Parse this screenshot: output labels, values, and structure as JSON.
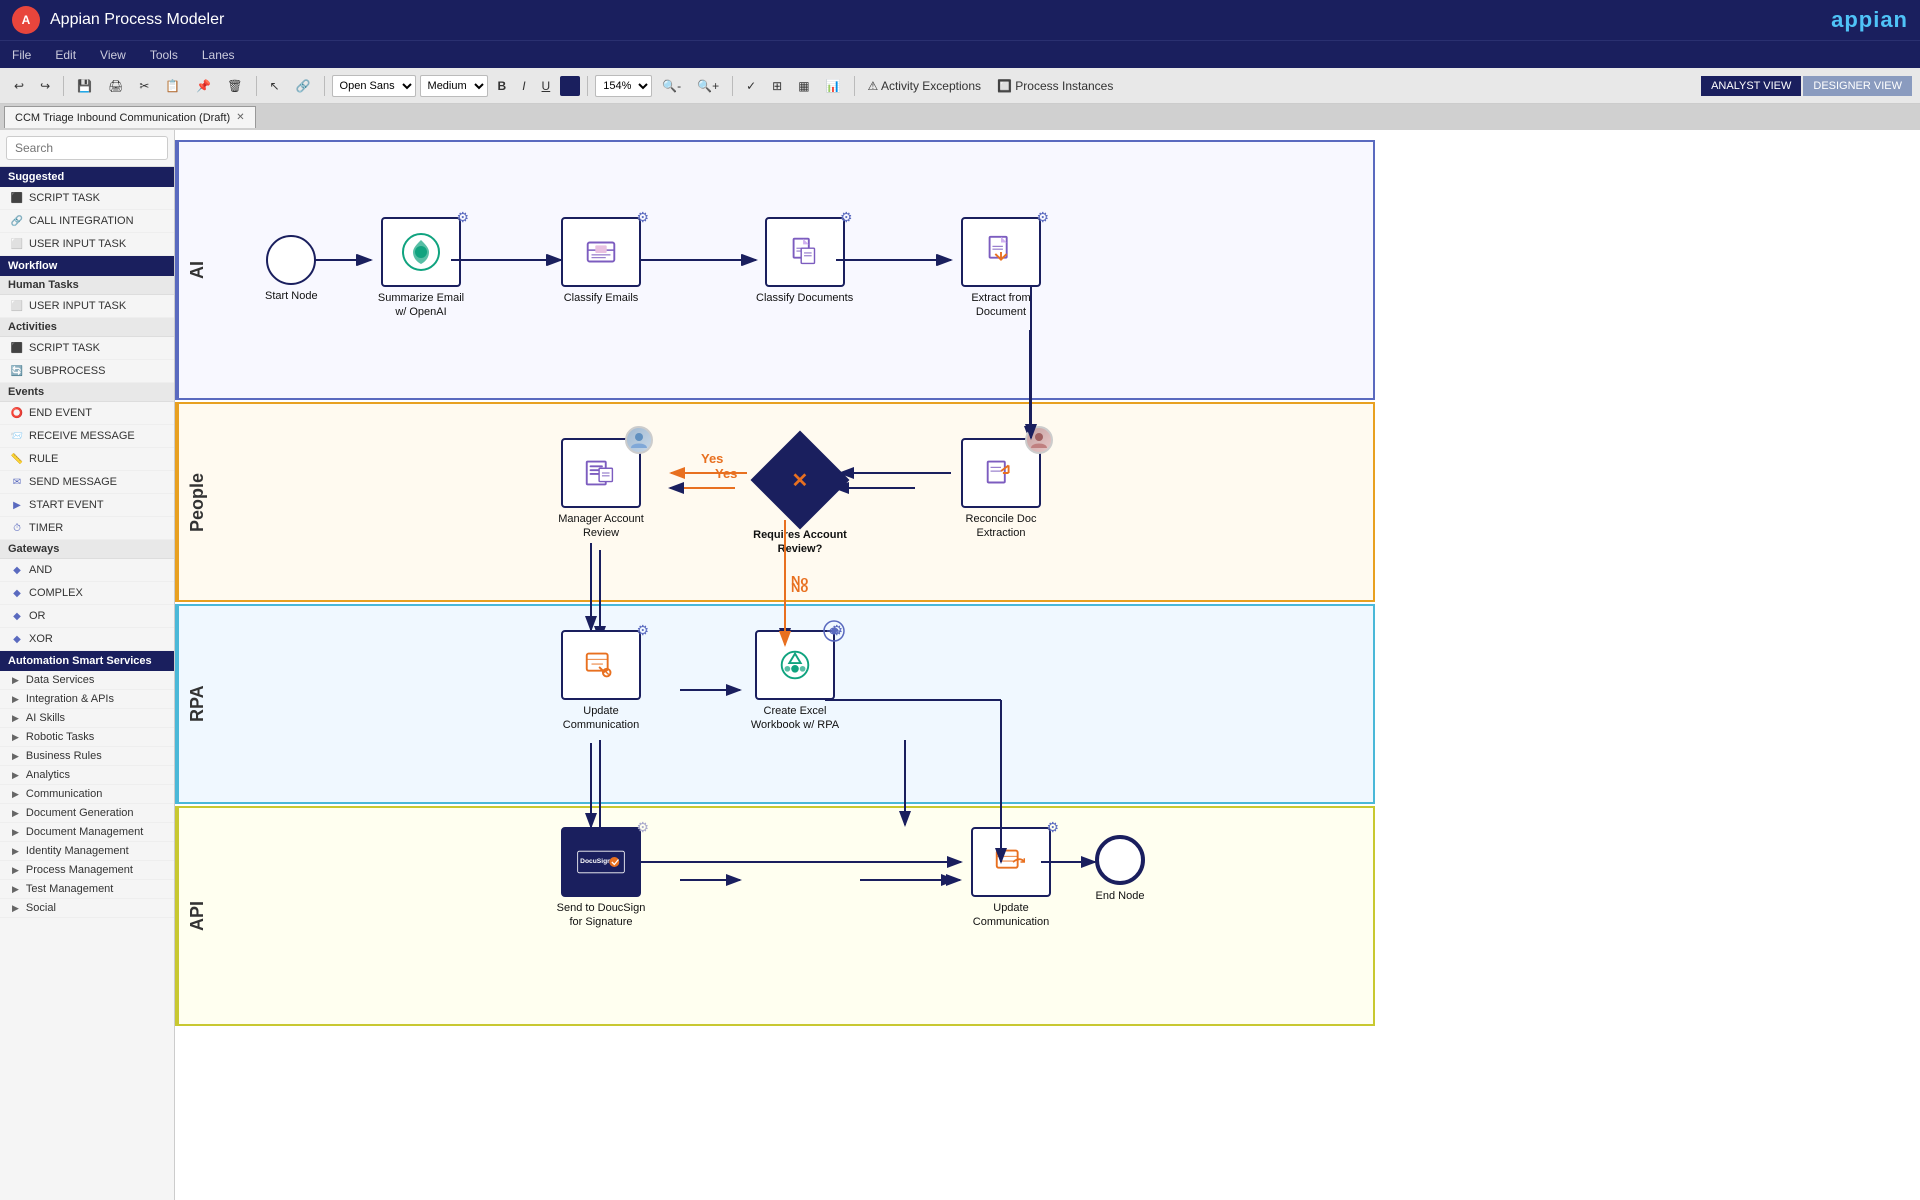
{
  "app": {
    "title": "Appian Process Modeler",
    "logo_text": "A",
    "appian_brand": "appian"
  },
  "menu": {
    "items": [
      "File",
      "Edit",
      "View",
      "Tools",
      "Lanes"
    ]
  },
  "toolbar": {
    "font": "Open Sans",
    "size": "Medium",
    "zoom": "154%",
    "activity_exceptions": "Activity Exceptions",
    "process_instances": "Process Instances",
    "analyst_view": "ANALYST VIEW",
    "designer_view": "DESIGNER VIEW"
  },
  "tab": {
    "label": "CCM Triage Inbound Communication (Draft)"
  },
  "sidebar": {
    "search_placeholder": "Search",
    "suggested_label": "Suggested",
    "suggested_items": [
      {
        "icon": "⬛",
        "label": "SCRIPT TASK"
      },
      {
        "icon": "🔗",
        "label": "CALL INTEGRATION"
      },
      {
        "icon": "📋",
        "label": "USER INPUT TASK"
      }
    ],
    "workflow_label": "Workflow",
    "human_tasks_label": "Human Tasks",
    "human_task_items": [
      {
        "icon": "📋",
        "label": "USER INPUT TASK"
      }
    ],
    "activities_label": "Activities",
    "activity_items": [
      {
        "icon": "⬛",
        "label": "SCRIPT TASK"
      },
      {
        "icon": "🔄",
        "label": "SUBPROCESS"
      }
    ],
    "events_label": "Events",
    "event_items": [
      {
        "icon": "⭕",
        "label": "END EVENT"
      },
      {
        "icon": "📨",
        "label": "RECEIVE MESSAGE"
      },
      {
        "icon": "📏",
        "label": "RULE"
      },
      {
        "icon": "✉️",
        "label": "SEND MESSAGE"
      },
      {
        "icon": "▶",
        "label": "START EVENT"
      },
      {
        "icon": "⏱",
        "label": "TIMER"
      }
    ],
    "gateways_label": "Gateways",
    "gateway_items": [
      {
        "icon": "◆",
        "label": "AND"
      },
      {
        "icon": "◆",
        "label": "COMPLEX"
      },
      {
        "icon": "◆",
        "label": "OR"
      },
      {
        "icon": "◆",
        "label": "XOR"
      }
    ],
    "automation_label": "Automation Smart Services",
    "automation_items": [
      "Data Services",
      "Integration & APIs",
      "AI Skills",
      "Robotic Tasks",
      "Business Rules",
      "Analytics",
      "Communication",
      "Document Generation",
      "Document Management",
      "Identity Management",
      "Process Management",
      "Test Management",
      "Social"
    ]
  },
  "lanes": [
    {
      "id": "ai",
      "label": "AI"
    },
    {
      "id": "people",
      "label": "People"
    },
    {
      "id": "rpa",
      "label": "RPA"
    },
    {
      "id": "api",
      "label": "API"
    }
  ],
  "nodes": {
    "start": {
      "label": "Start Node"
    },
    "summarize": {
      "label": "Summarize Email w/ OpenAI",
      "gear": true
    },
    "classify_emails": {
      "label": "Classify Emails",
      "gear": true
    },
    "classify_docs": {
      "label": "Classify Documents",
      "gear": true
    },
    "extract_doc": {
      "label": "Extract from Document",
      "gear": true
    },
    "reconcile": {
      "label": "Reconcile Doc Extraction",
      "avatar": true
    },
    "requires_review": {
      "label": "Requires Account Review?"
    },
    "manager_review": {
      "label": "Manager Account Review",
      "avatar": true
    },
    "update_comm1": {
      "label": "Update Communication",
      "gear": true
    },
    "create_excel": {
      "label": "Create Excel Workbook w/ RPA",
      "gear": true,
      "rpa": true
    },
    "send_docusign": {
      "label": "Send to DoucSign for Signature",
      "gear": true
    },
    "update_comm2": {
      "label": "Update Communication",
      "gear": true
    },
    "end": {
      "label": "End Node"
    },
    "yes_label": "Yes",
    "no_label": "No"
  }
}
